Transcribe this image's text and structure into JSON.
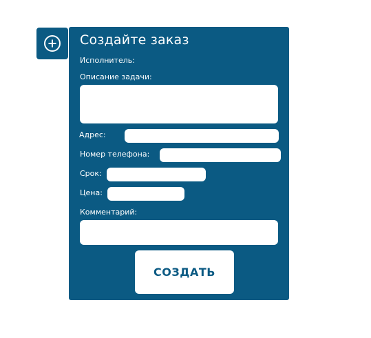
{
  "toggle": {
    "icon": "plus-circle-icon"
  },
  "form": {
    "title": "Создайте заказ",
    "executor_label": "Исполнитель:",
    "description_label": "Описание задачи:",
    "description_value": "",
    "address_label": "Адрес:",
    "address_value": "",
    "phone_label": "Номер телефона:",
    "phone_value": "",
    "deadline_label": "Срок:",
    "deadline_value": "",
    "price_label": "Цена:",
    "price_value": "",
    "comment_label": "Комментарий:",
    "comment_value": "",
    "submit_label": "СОЗДАТЬ"
  },
  "colors": {
    "panel_bg": "#0b5a83",
    "field_bg": "#ffffff",
    "text": "#ffffff",
    "button_text": "#0b5a83"
  }
}
